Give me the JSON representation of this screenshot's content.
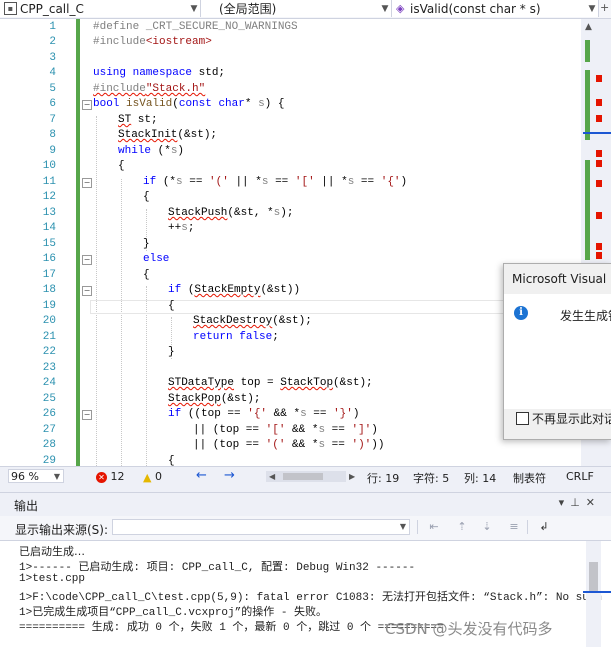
{
  "nav": {
    "project": "CPP_call_C",
    "scope": "(全局范围)",
    "member": "isValid(const char * s)"
  },
  "line_numbers": [
    "1",
    "2",
    "3",
    "4",
    "5",
    "6",
    "7",
    "8",
    "9",
    "10",
    "11",
    "12",
    "13",
    "14",
    "15",
    "16",
    "17",
    "18",
    "19",
    "20",
    "21",
    "22",
    "23",
    "24",
    "25",
    "26",
    "27",
    "28",
    "29"
  ],
  "code": {
    "l1a": "#define ",
    "l1b": "_CRT_SECURE_NO_WARNINGS",
    "l2a": "#include",
    "l2b": "<iostream>",
    "l4a": "using ",
    "l4b": "namespace ",
    "l4c": "std;",
    "l5a": "#include",
    "l5b": "\"Stack.h\"",
    "l6a": "bool ",
    "l6b": "isValid",
    "l6c": "(",
    "l6d": "const ",
    "l6e": "char",
    "l6f": "* ",
    "l6g": "s",
    "l6h": ") {",
    "l7a": "ST",
    "l7b": " st;",
    "l8a": "StackInit",
    "l8b": "(&st);",
    "l9a": "while ",
    "l9b": "(*",
    "l9c": "s",
    "l9d": ")",
    "l10": "{",
    "l11a": "if ",
    "l11b": "(*",
    "l11c": "s",
    "l11d": " == ",
    "l11e": "'('",
    "l11f": " || *",
    "l11g": "s",
    "l11h": " == ",
    "l11i": "'['",
    "l11j": " || *",
    "l11k": "s",
    "l11l": " == ",
    "l11m": "'{'",
    "l11n": ")",
    "l12": "{",
    "l13a": "StackPush",
    "l13b": "(&st, *",
    "l13c": "s",
    "l13d": ");",
    "l14a": "++",
    "l14b": "s",
    "l14c": ";",
    "l15": "}",
    "l16": "else",
    "l17": "{",
    "l18a": "if ",
    "l18b": "(",
    "l18c": "StackEmpty",
    "l18d": "(&st))",
    "l19": "{",
    "l20a": "StackDestroy",
    "l20b": "(&st);",
    "l21a": "return ",
    "l21b": "false",
    "l21c": ";",
    "l22": "}",
    "l24a": "STDataType",
    "l24b": " top = ",
    "l24c": "StackTop",
    "l24d": "(&st);",
    "l25a": "StackPop",
    "l25b": "(&st);",
    "l26a": "if ",
    "l26b": "((top == ",
    "l26c": "'{'",
    "l26d": " && *",
    "l26e": "s",
    "l26f": " == ",
    "l26g": "'}'",
    "l26h": ")",
    "l27a": "|| (top == ",
    "l27b": "'['",
    "l27c": " && *",
    "l27d": "s",
    "l27e": " == ",
    "l27f": "']'",
    "l27g": ")",
    "l28a": "|| (top == ",
    "l28b": "'('",
    "l28c": " && *",
    "l28d": "s",
    "l28e": " == ",
    "l28f": "')'",
    "l28g": "))",
    "l29": "{"
  },
  "dialog": {
    "title": "Microsoft Visual",
    "message": "发生生成错",
    "checkbox_label": "不再显示此对话"
  },
  "status": {
    "zoom": "96 %",
    "errors": "12",
    "warnings": "0",
    "line": "行: 19",
    "char": "字符: 5",
    "col": "列: 14",
    "tabs": "制表符",
    "eol": "CRLF"
  },
  "output_panel": {
    "title": "输出",
    "source_label": "显示输出来源(S):",
    "lines": [
      "已启动生成…",
      "1>------ 已启动生成: 项目: CPP_call_C, 配置: Debug Win32 ------",
      "1>test.cpp",
      "1>F:\\code\\CPP_call_C\\test.cpp(5,9): fatal error C1083: 无法打开包括文件: “Stack.h”: No such",
      "1>已完成生成项目“CPP_call_C.vcxproj”的操作 - 失败。",
      "========== 生成: 成功 0 个，失败 1 个，最新 0 个，跳过 0 个 =========="
    ]
  },
  "watermark": "CSDN @头发没有代码多",
  "colors": {
    "keyword": "#0000ff",
    "string": "#a31515",
    "type": "#2b91af",
    "preprocessor": "#808080",
    "error": "#e51400",
    "change_bar": "#57a64a"
  }
}
